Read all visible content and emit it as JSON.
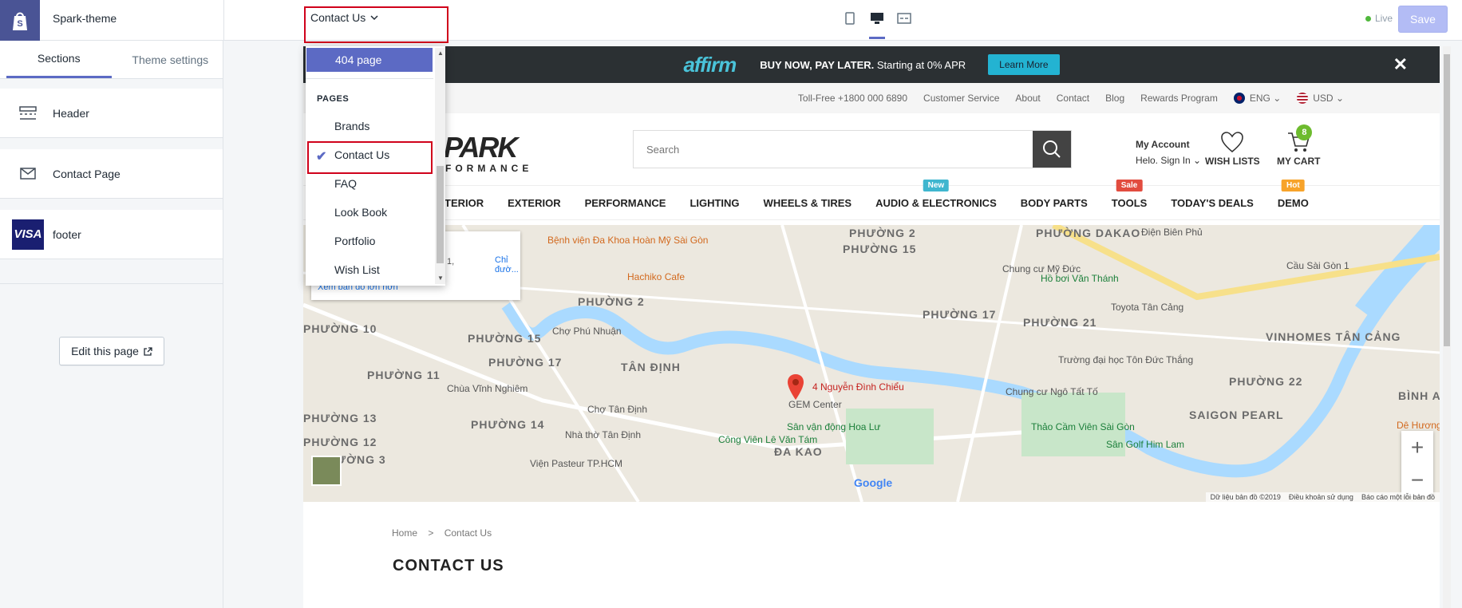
{
  "topbar": {
    "theme_name": "Spark-theme",
    "page_select_value": "Contact Us",
    "live_label": "Live",
    "save_label": "Save"
  },
  "sidebar": {
    "tabs": [
      {
        "label": "Sections"
      },
      {
        "label": "Theme settings"
      }
    ],
    "sections": [
      {
        "label": "Header",
        "icon": "header-layout-icon"
      },
      {
        "label": "Contact Page",
        "icon": "envelope-icon"
      },
      {
        "label": "footer",
        "icon": "visa-icon"
      }
    ],
    "visa_text": "VISA",
    "edit_page_label": "Edit this page"
  },
  "dropdown": {
    "selected_top": "404 page",
    "group_caption": "PAGES",
    "items": [
      "Brands",
      "Contact Us",
      "FAQ",
      "Look Book",
      "Portfolio",
      "Wish List"
    ],
    "checked_item": "Contact Us"
  },
  "store": {
    "affirm_logo": "affirm",
    "affirm_bold": "BUY NOW, PAY LATER.",
    "affirm_rest": " Starting at 0% APR",
    "learn_more": "Learn More",
    "close_glyph": "✕",
    "toplinks": [
      "Toll-Free +1800 000 6890",
      "Customer Service",
      "About",
      "Contact",
      "Blog",
      "Rewards Program"
    ],
    "language": "ENG",
    "currency": "USD",
    "brand_main": "PARK",
    "brand_sub": "FORMANCE",
    "search_placeholder": "Search",
    "my_account": "My Account",
    "sign_in": "Helo. Sign In",
    "wish_lists": "WISH LISTS",
    "my_cart": "MY CART",
    "cart_count": "8",
    "nav": [
      {
        "label": "INTERIOR",
        "tag": ""
      },
      {
        "label": "EXTERIOR",
        "tag": ""
      },
      {
        "label": "PERFORMANCE",
        "tag": ""
      },
      {
        "label": "LIGHTING",
        "tag": ""
      },
      {
        "label": "WHEELS & TIRES",
        "tag": ""
      },
      {
        "label": "AUDIO & ELECTRONICS",
        "tag": "New"
      },
      {
        "label": "BODY PARTS",
        "tag": ""
      },
      {
        "label": "TOOLS",
        "tag": "Sale"
      },
      {
        "label": "TODAY'S DEALS",
        "tag": ""
      },
      {
        "label": "DEMO",
        "tag": "Hot"
      }
    ],
    "tag_colors": {
      "New": "#3fb6cf",
      "Sale": "#e24c3f",
      "Hot": "#f7a32a"
    },
    "map": {
      "address_snip": "Quận 1,",
      "directions": "Chỉ đườ...",
      "larger_map": "Xem bản đồ lớn hơn",
      "marker_label": "4 Nguyễn Đình Chiểu",
      "footer_data": "Dữ liệu bản đồ ©2019",
      "footer_terms": "Điều khoản sử dụng",
      "footer_report": "Báo cáo một lỗi bản đồ",
      "google": "Google",
      "labels": [
        {
          "text": "PHƯỜNG 2",
          "kind": "big"
        },
        {
          "text": "PHƯỜNG DAKAO",
          "kind": "big"
        },
        {
          "text": "PHƯỜNG 15",
          "kind": "big"
        },
        {
          "text": "PHƯỜNG 2",
          "kind": "big"
        },
        {
          "text": "PHƯỜNG 17",
          "kind": "big"
        },
        {
          "text": "PHƯỜNG 21",
          "kind": "big"
        },
        {
          "text": "PHƯỜNG 10",
          "kind": "big"
        },
        {
          "text": "PHƯỜNG 15",
          "kind": "big"
        },
        {
          "text": "PHƯỜNG 17",
          "kind": "big"
        },
        {
          "text": "TÂN ĐỊNH",
          "kind": "big"
        },
        {
          "text": "PHƯỜNG 11",
          "kind": "big"
        },
        {
          "text": "PHƯỜNG 13",
          "kind": "big"
        },
        {
          "text": "PHƯỜNG 14",
          "kind": "big"
        },
        {
          "text": "PHƯỜNG 12",
          "kind": "big"
        },
        {
          "text": "PHƯỜNG 3",
          "kind": "big"
        },
        {
          "text": "ĐA KAO",
          "kind": "big"
        },
        {
          "text": "VINHOMES TÂN CẢNG",
          "kind": "big"
        },
        {
          "text": "PHƯỜNG 22",
          "kind": "big"
        },
        {
          "text": "SAIGON PEARL",
          "kind": "big"
        },
        {
          "text": "Bệnh viện Đa Khoa Hoàn Mỹ Sài Gòn",
          "kind": "poi"
        },
        {
          "text": "Hachiko Cafe",
          "kind": "poi"
        },
        {
          "text": "Chung cư Mỹ Đức",
          "kind": "plain"
        },
        {
          "text": "Hồ bơi Văn Thánh",
          "kind": "grn"
        },
        {
          "text": "Cầu Sài Gòn 1",
          "kind": "plain"
        },
        {
          "text": "Toyota Tân Cảng",
          "kind": "plain"
        },
        {
          "text": "Chợ Phú Nhuận",
          "kind": "plain"
        },
        {
          "text": "Trường đại học Tôn Đức Thắng",
          "kind": "plain"
        },
        {
          "text": "Chùa Vĩnh Nghiêm",
          "kind": "plain"
        },
        {
          "text": "Chợ Tân Định",
          "kind": "plain"
        },
        {
          "text": "GEM Center",
          "kind": "plain"
        },
        {
          "text": "Chung cư Ngô Tất Tố",
          "kind": "plain"
        },
        {
          "text": "Nhà thờ Tân Định",
          "kind": "plain"
        },
        {
          "text": "Sân vận động Hoa Lư",
          "kind": "grn"
        },
        {
          "text": "Thảo Cầm Viên Sài Gòn",
          "kind": "grn"
        },
        {
          "text": "Sân Golf Him Lam",
          "kind": "grn"
        },
        {
          "text": "Công Viên Lê Văn Tám",
          "kind": "grn"
        },
        {
          "text": "Viện Pasteur TP.HCM",
          "kind": "plain"
        },
        {
          "text": "Điện Biên Phủ",
          "kind": "plain"
        },
        {
          "text": "BÌNH A",
          "kind": "big"
        },
        {
          "text": "Dê Hương",
          "kind": "poi"
        }
      ]
    },
    "breadcrumb": {
      "home": "Home",
      "sep": ">",
      "current": "Contact Us"
    },
    "page_title": "CONTACT US"
  },
  "colors": {
    "accent": "#5c6ac4",
    "highlight_border": "#d0021b",
    "topbar_logo_bg": "#4a5495"
  }
}
